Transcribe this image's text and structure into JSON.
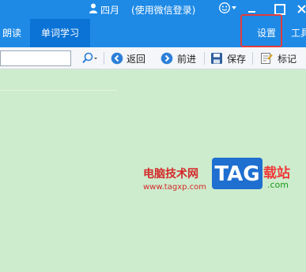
{
  "titlebar": {
    "user_name": "四月",
    "login_note": "(使用微信登录)",
    "icons": [
      "user-icon",
      "skin-icon",
      "dropdown-icon",
      "minimize-icon",
      "maximize-icon",
      "close-icon"
    ]
  },
  "tabs": [
    {
      "label": "朗读"
    },
    {
      "label": "单词学习",
      "active": true
    },
    {
      "label": "设置"
    },
    {
      "label": "工具"
    }
  ],
  "toolbar": {
    "search_value": "",
    "back_label": "返回",
    "forward_label": "前进",
    "save_label": "保存",
    "mark_label": "标记"
  },
  "watermark": {
    "text": "电脑技术网",
    "url": "www.tagxp.com",
    "logo": "TAG",
    "site": "载站",
    "domain": ".com"
  },
  "colors": {
    "header_blue": "#1e8ae6",
    "active_tab": "#0b73d6",
    "content_bg": "#cdeccd",
    "highlight_red": "#e23b3b"
  }
}
